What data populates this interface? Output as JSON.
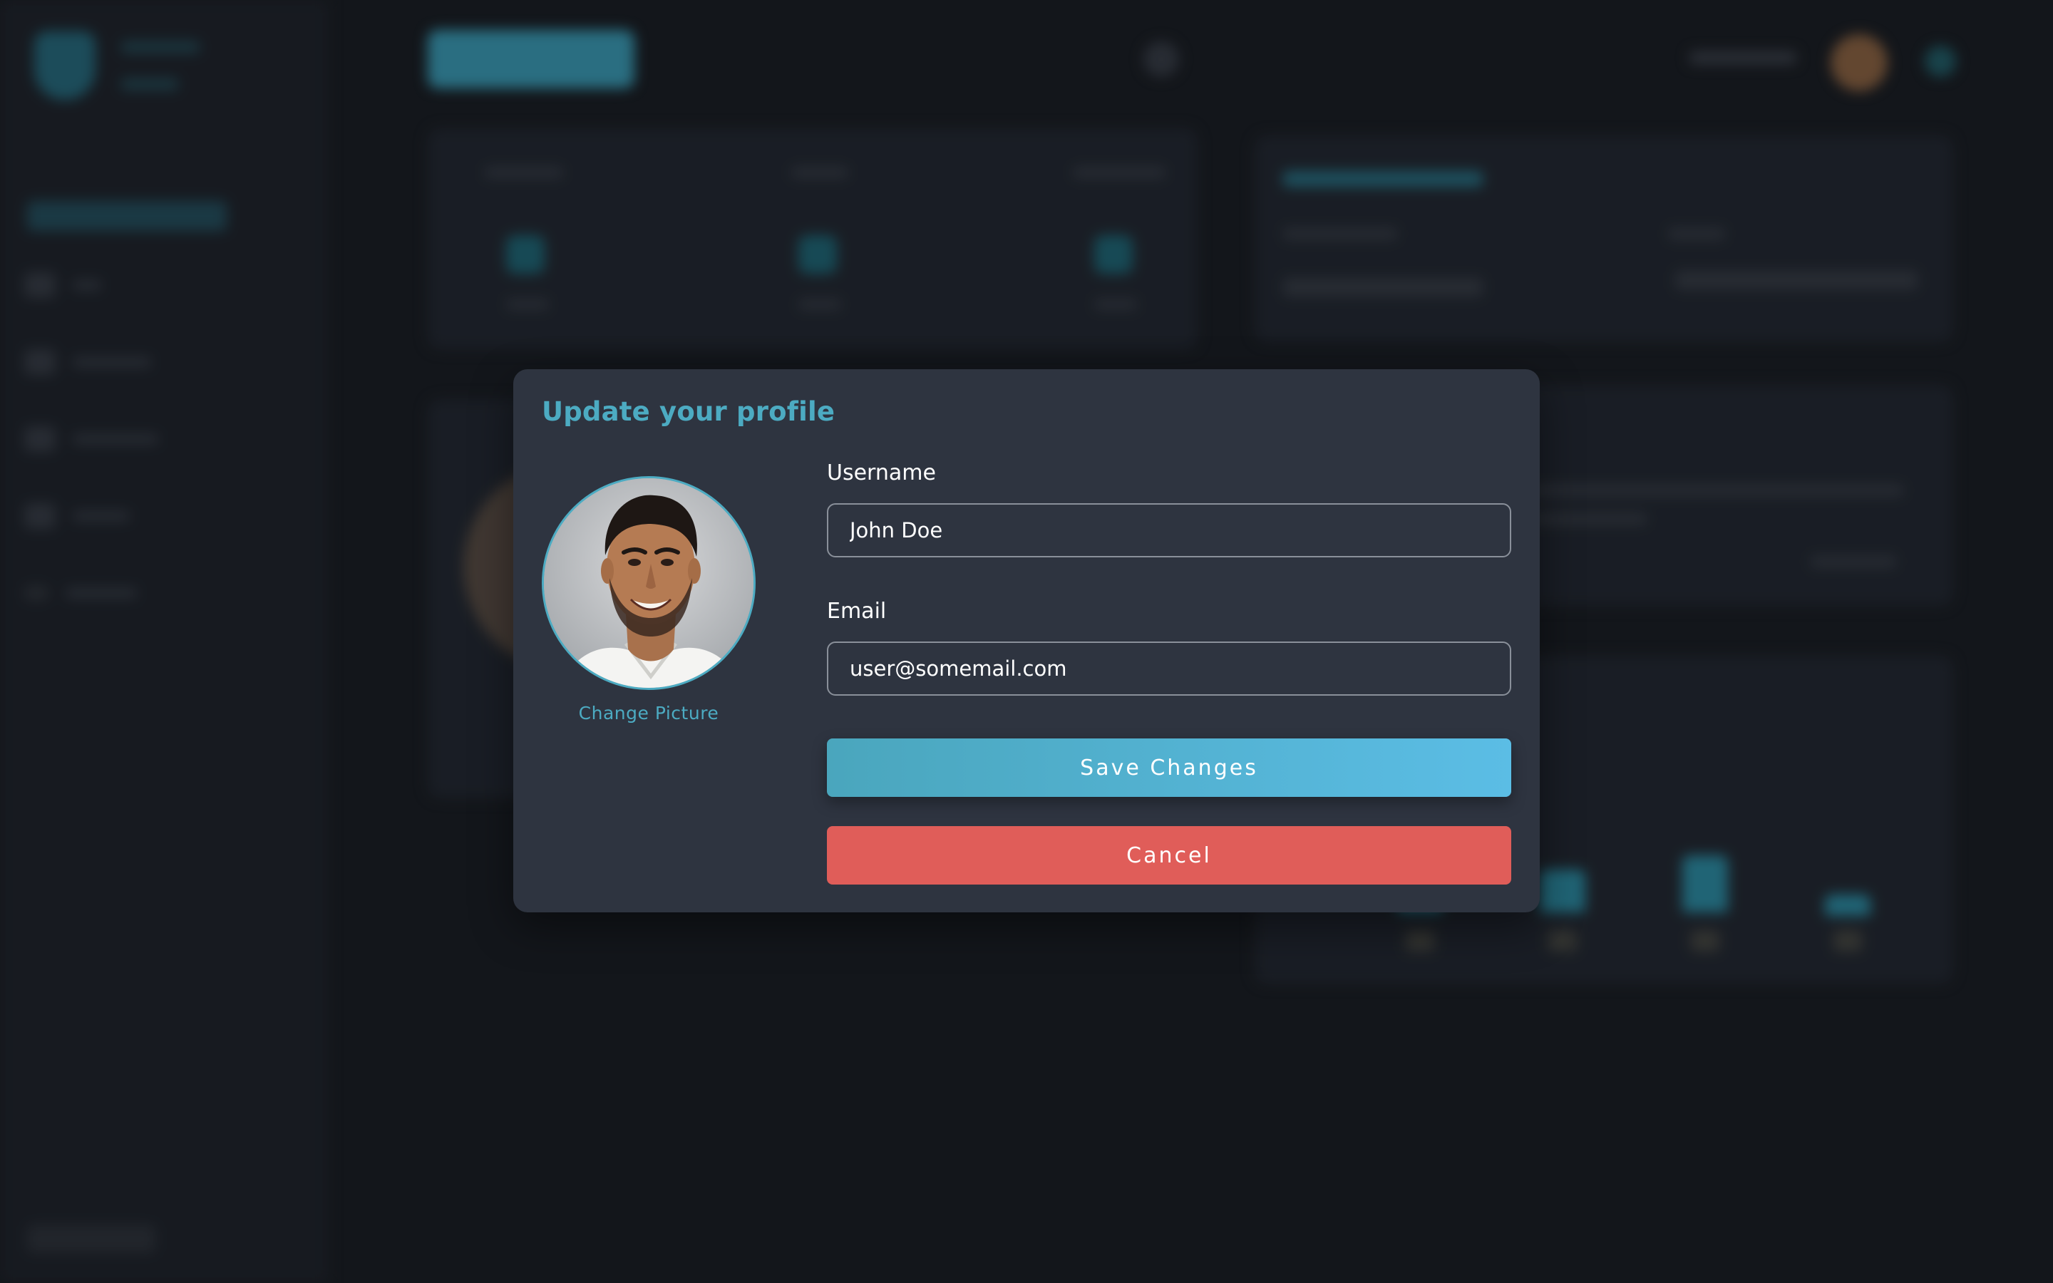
{
  "modal": {
    "title": "Update your profile",
    "change_picture_label": "Change Picture",
    "username": {
      "label": "Username",
      "value": "John Doe"
    },
    "email": {
      "label": "Email",
      "value": "user@somemail.com"
    },
    "save_label": "Save Changes",
    "cancel_label": "Cancel"
  },
  "colors": {
    "accent": "#4cabc2",
    "modal_bg": "#2e3440",
    "cancel": "#e05d59",
    "save_gradient_start": "#4aa6bd",
    "save_gradient_end": "#5bbde5"
  },
  "icons": {
    "avatar": "profile-photo"
  }
}
